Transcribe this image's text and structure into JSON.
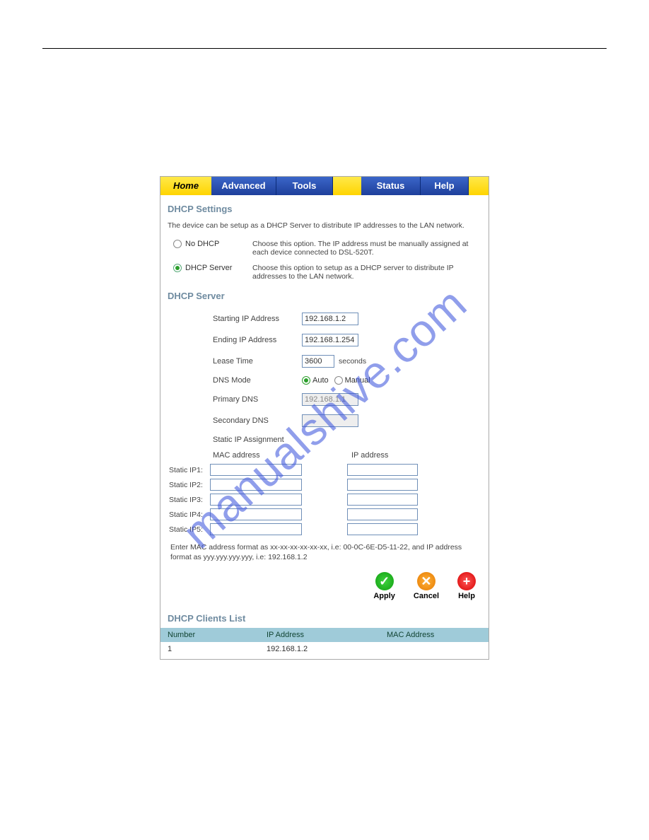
{
  "watermark": "manualshive.com",
  "tabs": {
    "home": "Home",
    "advanced": "Advanced",
    "tools": "Tools",
    "status": "Status",
    "help": "Help"
  },
  "dhcp_settings": {
    "title": "DHCP Settings",
    "intro": "The device can be setup as a DHCP Server to distribute IP addresses to the LAN network.",
    "no_dhcp": {
      "label": "No DHCP",
      "desc": "Choose this option. The IP address must be manually assigned at each device connected to DSL-520T."
    },
    "dhcp_server": {
      "label": "DHCP Server",
      "desc": "Choose this option to setup as a DHCP server to distribute IP addresses to the LAN network."
    }
  },
  "dhcp_server_section": {
    "title": "DHCP Server",
    "starting_ip": {
      "label": "Starting IP Address",
      "value": "192.168.1.2"
    },
    "ending_ip": {
      "label": "Ending IP Address",
      "value": "192.168.1.254"
    },
    "lease_time": {
      "label": "Lease Time",
      "value": "3600",
      "suffix": "seconds"
    },
    "dns_mode": {
      "label": "DNS Mode",
      "auto": "Auto",
      "manual": "Manual"
    },
    "primary_dns": {
      "label": "Primary DNS",
      "value": "192.168.1.1"
    },
    "secondary_dns": {
      "label": "Secondary DNS",
      "value": ""
    },
    "static_ip_heading": "Static IP Assignment",
    "mac_col": "MAC address",
    "ip_col": "IP address",
    "rows": [
      {
        "label": "Static IP1:"
      },
      {
        "label": "Static IP2:"
      },
      {
        "label": "Static IP3:"
      },
      {
        "label": "Static IP4:"
      },
      {
        "label": "Static IP5:"
      }
    ],
    "hint": "Enter MAC address format as xx-xx-xx-xx-xx-xx, i.e: 00-0C-6E-D5-11-22, and IP address format as yyy.yyy.yyy.yyy, i.e: 192.168.1.2"
  },
  "buttons": {
    "apply": "Apply",
    "cancel": "Cancel",
    "help": "Help"
  },
  "clients": {
    "title": "DHCP Clients List",
    "headers": {
      "number": "Number",
      "ip": "IP Address",
      "mac": "MAC Address"
    },
    "rows": [
      {
        "number": "1",
        "ip": "192.168.1.2",
        "mac": ""
      }
    ]
  }
}
